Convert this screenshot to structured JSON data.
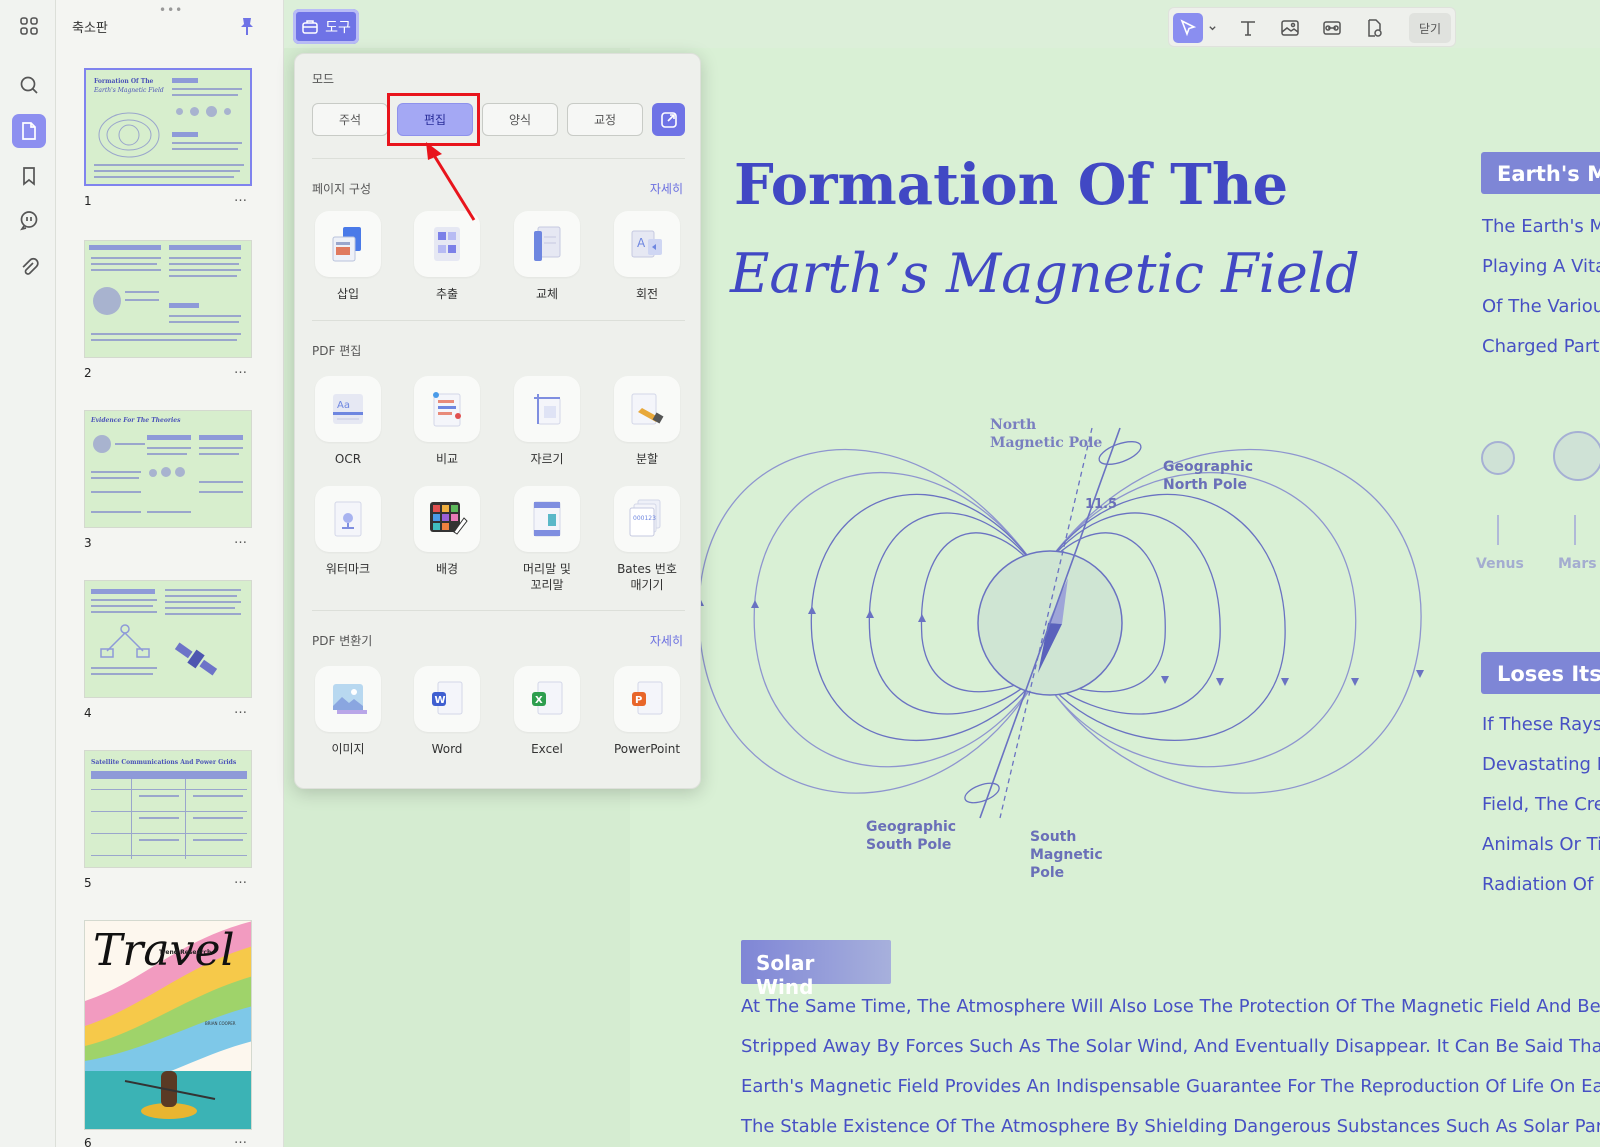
{
  "rail": {
    "items": [
      "grid",
      "search",
      "pages",
      "bookmark",
      "comment",
      "attachment"
    ]
  },
  "thumbnails": {
    "title": "축소판",
    "grip": "•••",
    "pages": [
      {
        "num": "1",
        "more": "…",
        "mini_title_1": "Formation Of The",
        "mini_title_2": "Earth's Magnetic Field"
      },
      {
        "num": "2",
        "more": "…"
      },
      {
        "num": "3",
        "more": "…",
        "mini_title_1": "Evidence For The Theories"
      },
      {
        "num": "4",
        "more": "…"
      },
      {
        "num": "5",
        "more": "…",
        "mini_title_1": "Satellite Communications And Power Grids"
      },
      {
        "num": "6",
        "more": "…",
        "mini_title_1": "Travel",
        "mini_sub": "Trend Research",
        "mini_author": "BRIAN COOPER"
      }
    ]
  },
  "tools_button": {
    "label": "도구"
  },
  "toolbar": {
    "close_label": "닫기"
  },
  "popup": {
    "mode_title": "모드",
    "modes": [
      "주석",
      "편집",
      "양식",
      "교정"
    ],
    "active_mode": "편집",
    "page_section": {
      "title": "페이지 구성",
      "more": "자세히",
      "tools": [
        "삽입",
        "추출",
        "교체",
        "회전"
      ]
    },
    "edit_section": {
      "title": "PDF 편집",
      "tools": [
        "OCR",
        "비교",
        "자르기",
        "분할",
        "워터마크",
        "배경",
        "머리말 및\n꼬리말",
        "Bates 번호\n매기기"
      ]
    },
    "convert_section": {
      "title": "PDF 변환기",
      "more": "자세히",
      "tools": [
        "이미지",
        "Word",
        "Excel",
        "PowerPoint"
      ]
    }
  },
  "document": {
    "title_line1": "Formation Of The",
    "title_line2": "Earth’s Magnetic Field",
    "diagram": {
      "north_magnetic": "North\nMagnetic Pole",
      "geo_north": "Geographic\nNorth Pole",
      "geo_south": "Geographic\nSouth Pole",
      "south_magnetic": "South\nMagnetic\nPole",
      "angle": "11.5"
    },
    "side_badge_1": "Earth's M",
    "side_lines_1": [
      "The Earth's Ma",
      "Playing A Vita",
      "Of The Various",
      "Charged Partic"
    ],
    "planets": [
      "Venus",
      "Mars"
    ],
    "side_badge_2": "Loses Its I",
    "side_lines_2": [
      "If These Rays",
      "Devastating B",
      "Field, The Cre",
      "Animals Or Tin",
      "Radiation Of S"
    ],
    "solar_badge": "Solar Wind",
    "body_lines": [
      "At The Same Time, The Atmosphere Will Also Lose The Protection Of The Magnetic Field And Be Grad",
      "Stripped Away By Forces Such As The Solar Wind, And Eventually Disappear. It Can Be Said That The",
      "Earth's Magnetic Field Provides An Indispensable Guarantee For The Reproduction Of Life On Earth A",
      "The Stable Existence Of The Atmosphere By Shielding Dangerous Substances Such As Solar Particles"
    ]
  },
  "colors": {
    "accent": "#6f73e6",
    "doc_text": "#4148c4",
    "annotation": "#e8141c"
  }
}
